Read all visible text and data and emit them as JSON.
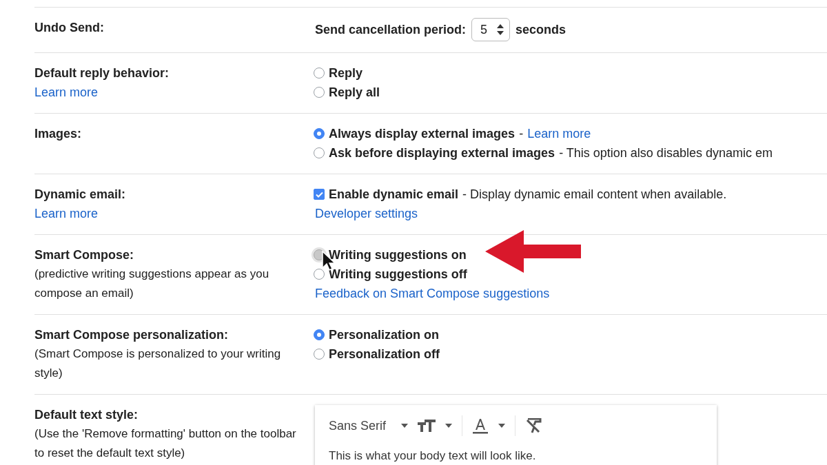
{
  "settings": [
    {
      "kind": "select",
      "title": "Undo Send:",
      "label": "Send cancellation period:",
      "value": "5",
      "unit": "seconds"
    },
    {
      "kind": "radio",
      "title": "Default reply behavior:",
      "title_link": "Learn more",
      "options": [
        {
          "label": "Reply",
          "selected": false
        },
        {
          "label": "Reply all",
          "selected": false
        }
      ]
    },
    {
      "kind": "radio",
      "title": "Images:",
      "options": [
        {
          "label": "Always display external images",
          "note": "-",
          "link": "Learn more",
          "selected": true
        },
        {
          "label": "Ask before displaying external images",
          "note": "- This option also disables dynamic em",
          "selected": false
        }
      ]
    },
    {
      "kind": "checkbox",
      "title": "Dynamic email:",
      "title_link": "Learn more",
      "label": "Enable dynamic email",
      "note": "- Display dynamic email content when available.",
      "checked": true,
      "link": "Developer settings"
    },
    {
      "kind": "radio",
      "title": "Smart Compose:",
      "description": "(predictive writing suggestions appear as you compose an email)",
      "options": [
        {
          "label": "Writing suggestions on",
          "selected": false,
          "hover": true
        },
        {
          "label": "Writing suggestions off",
          "selected": false
        }
      ],
      "link": "Feedback on Smart Compose suggestions"
    },
    {
      "kind": "radio",
      "title": "Smart Compose personalization:",
      "description": "(Smart Compose is personalized to your writing style)",
      "options": [
        {
          "label": "Personalization on",
          "selected": true
        },
        {
          "label": "Personalization off",
          "selected": false
        }
      ]
    },
    {
      "kind": "editor",
      "title": "Default text style:",
      "description": "(Use the 'Remove formatting' button on the toolbar to reset the default text style)",
      "font": "Sans Serif",
      "sample": "This is what your body text will look like."
    }
  ]
}
